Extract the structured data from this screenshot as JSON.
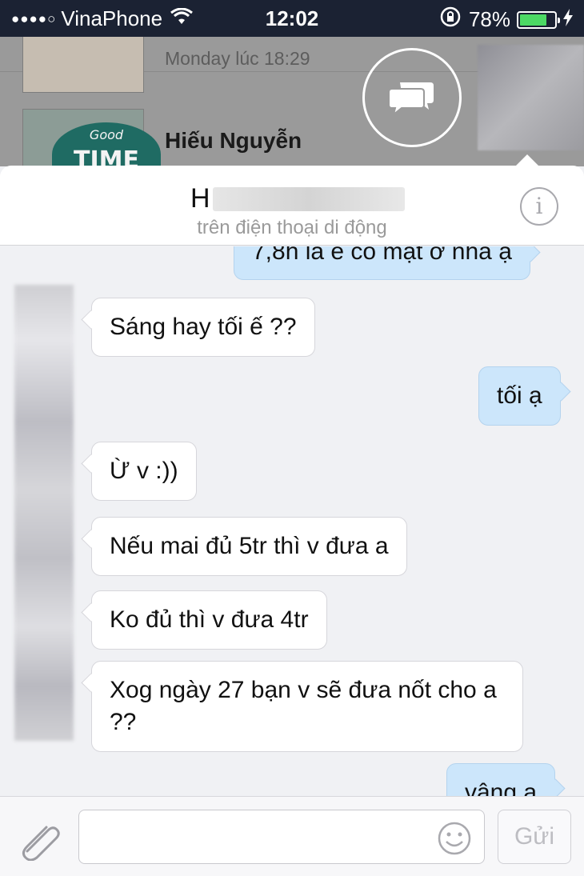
{
  "status_bar": {
    "signal_dots": "●●●●○",
    "carrier": "VinaPhone",
    "time": "12:02",
    "battery_percent": "78%",
    "battery_level": 0.78,
    "battery_color": "#4cd964",
    "icons": [
      "wifi-icon",
      "orientation-lock-icon",
      "battery-icon",
      "charging-icon"
    ]
  },
  "inbox_background": {
    "row1_meta": "Monday lúc 18:29",
    "row2_name": "Hiếu Nguyễn",
    "row2_logo_top": "Good",
    "row2_logo_text": "TIME"
  },
  "chat_header": {
    "title_visible": "H",
    "subtitle": "trên điện thoại di động",
    "info_glyph": "i"
  },
  "messages": [
    {
      "dir": "out",
      "text": "7,8h là e có mặt ở nhà ạ"
    },
    {
      "dir": "in",
      "text": "Sáng hay tối ế ??"
    },
    {
      "dir": "out",
      "text": "tối ạ"
    },
    {
      "dir": "in",
      "text": "Ừ v :))"
    },
    {
      "dir": "in",
      "text": "Nếu mai đủ 5tr thì v đưa a"
    },
    {
      "dir": "in",
      "text": "Ko đủ thì v đưa 4tr"
    },
    {
      "dir": "in",
      "text": "Xog ngày 27 bạn v sẽ đưa nốt cho a ??"
    },
    {
      "dir": "out",
      "text": "vâng a"
    }
  ],
  "composer": {
    "input_value": "",
    "send_label": "Gửi"
  },
  "colors": {
    "outgoing_bubble": "#cce6fb",
    "incoming_bubble": "#ffffff",
    "status_bar_bg": "#1b2233"
  }
}
